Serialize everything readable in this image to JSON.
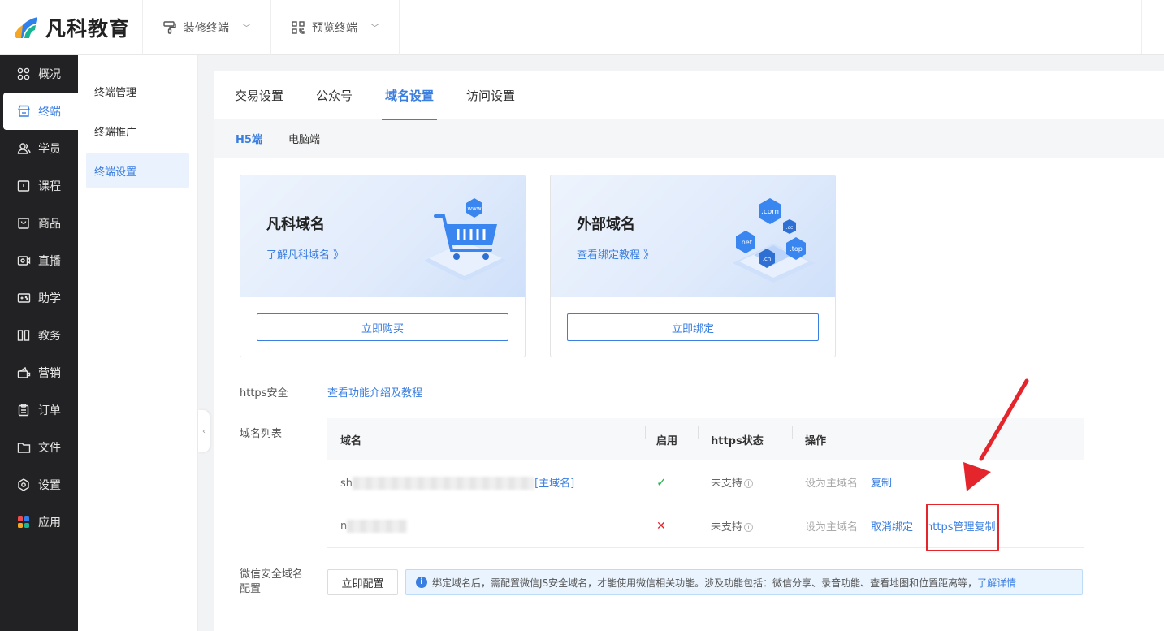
{
  "brand": {
    "name": "凡科教育"
  },
  "topnav": [
    {
      "label": "装修终端",
      "icon": "paint-roller-icon"
    },
    {
      "label": "预览终端",
      "icon": "qr-code-icon"
    }
  ],
  "sidebar": [
    {
      "label": "概况",
      "icon": "grid-icon",
      "active": false
    },
    {
      "label": "终端",
      "icon": "store-icon",
      "active": true
    },
    {
      "label": "学员",
      "icon": "users-icon",
      "active": false
    },
    {
      "label": "课程",
      "icon": "course-icon",
      "active": false
    },
    {
      "label": "商品",
      "icon": "bag-icon",
      "active": false
    },
    {
      "label": "直播",
      "icon": "live-icon",
      "active": false
    },
    {
      "label": "助学",
      "icon": "gamepad-icon",
      "active": false
    },
    {
      "label": "教务",
      "icon": "book-icon",
      "active": false
    },
    {
      "label": "营销",
      "icon": "marketing-icon",
      "active": false
    },
    {
      "label": "订单",
      "icon": "clipboard-icon",
      "active": false
    },
    {
      "label": "文件",
      "icon": "folder-icon",
      "active": false
    },
    {
      "label": "设置",
      "icon": "settings-icon",
      "active": false
    },
    {
      "label": "应用",
      "icon": "apps-icon",
      "active": false
    }
  ],
  "subsidebar": [
    {
      "label": "终端管理",
      "active": false
    },
    {
      "label": "终端推广",
      "active": false
    },
    {
      "label": "终端设置",
      "active": true
    }
  ],
  "tabs": [
    {
      "label": "交易设置",
      "active": false
    },
    {
      "label": "公众号",
      "active": false
    },
    {
      "label": "域名设置",
      "active": true
    },
    {
      "label": "访问设置",
      "active": false
    }
  ],
  "subtabs": [
    {
      "label": "H5端",
      "active": true
    },
    {
      "label": "电脑端",
      "active": false
    }
  ],
  "cards": [
    {
      "title": "凡科域名",
      "link": "了解凡科域名 》",
      "button": "立即购买"
    },
    {
      "title": "外部域名",
      "link": "查看绑定教程 》",
      "button": "立即绑定"
    }
  ],
  "illustration": {
    "www": "www",
    "com": ".com",
    "cc": ".cc",
    "net": ".net",
    "top": ".top",
    "cn": ".cn"
  },
  "https": {
    "label": "https安全",
    "link": "查看功能介绍及教程"
  },
  "domain_list": {
    "label": "域名列表",
    "columns": [
      "域名",
      "启用",
      "https状态",
      "操作"
    ],
    "rows": [
      {
        "domain_prefix": "sh",
        "tag": "[主域名]",
        "enabled": "✓",
        "https_status": "未支持",
        "actions": [
          {
            "label": "设为主域名",
            "muted": true
          },
          {
            "label": "复制",
            "muted": false
          }
        ]
      },
      {
        "domain_prefix": "n",
        "tag": "",
        "enabled": "✕",
        "https_status": "未支持",
        "actions": [
          {
            "label": "设为主域名",
            "muted": true
          },
          {
            "label": "取消绑定",
            "muted": false
          },
          {
            "label": "https管理",
            "muted": false
          },
          {
            "label": "复制",
            "muted": false
          }
        ]
      }
    ]
  },
  "wechat": {
    "label_line1": "微信安全域名",
    "label_line2": "配置",
    "button": "立即配置",
    "notice": "绑定域名后，需配置微信JS安全域名，才能使用微信相关功能。涉及功能包括：微信分享、录音功能、查看地图和位置距离等，",
    "notice_link": "了解详情"
  },
  "colors": {
    "accent": "#3a7ee0",
    "sidebar_bg": "#222224",
    "annotation": "#e5252c"
  }
}
